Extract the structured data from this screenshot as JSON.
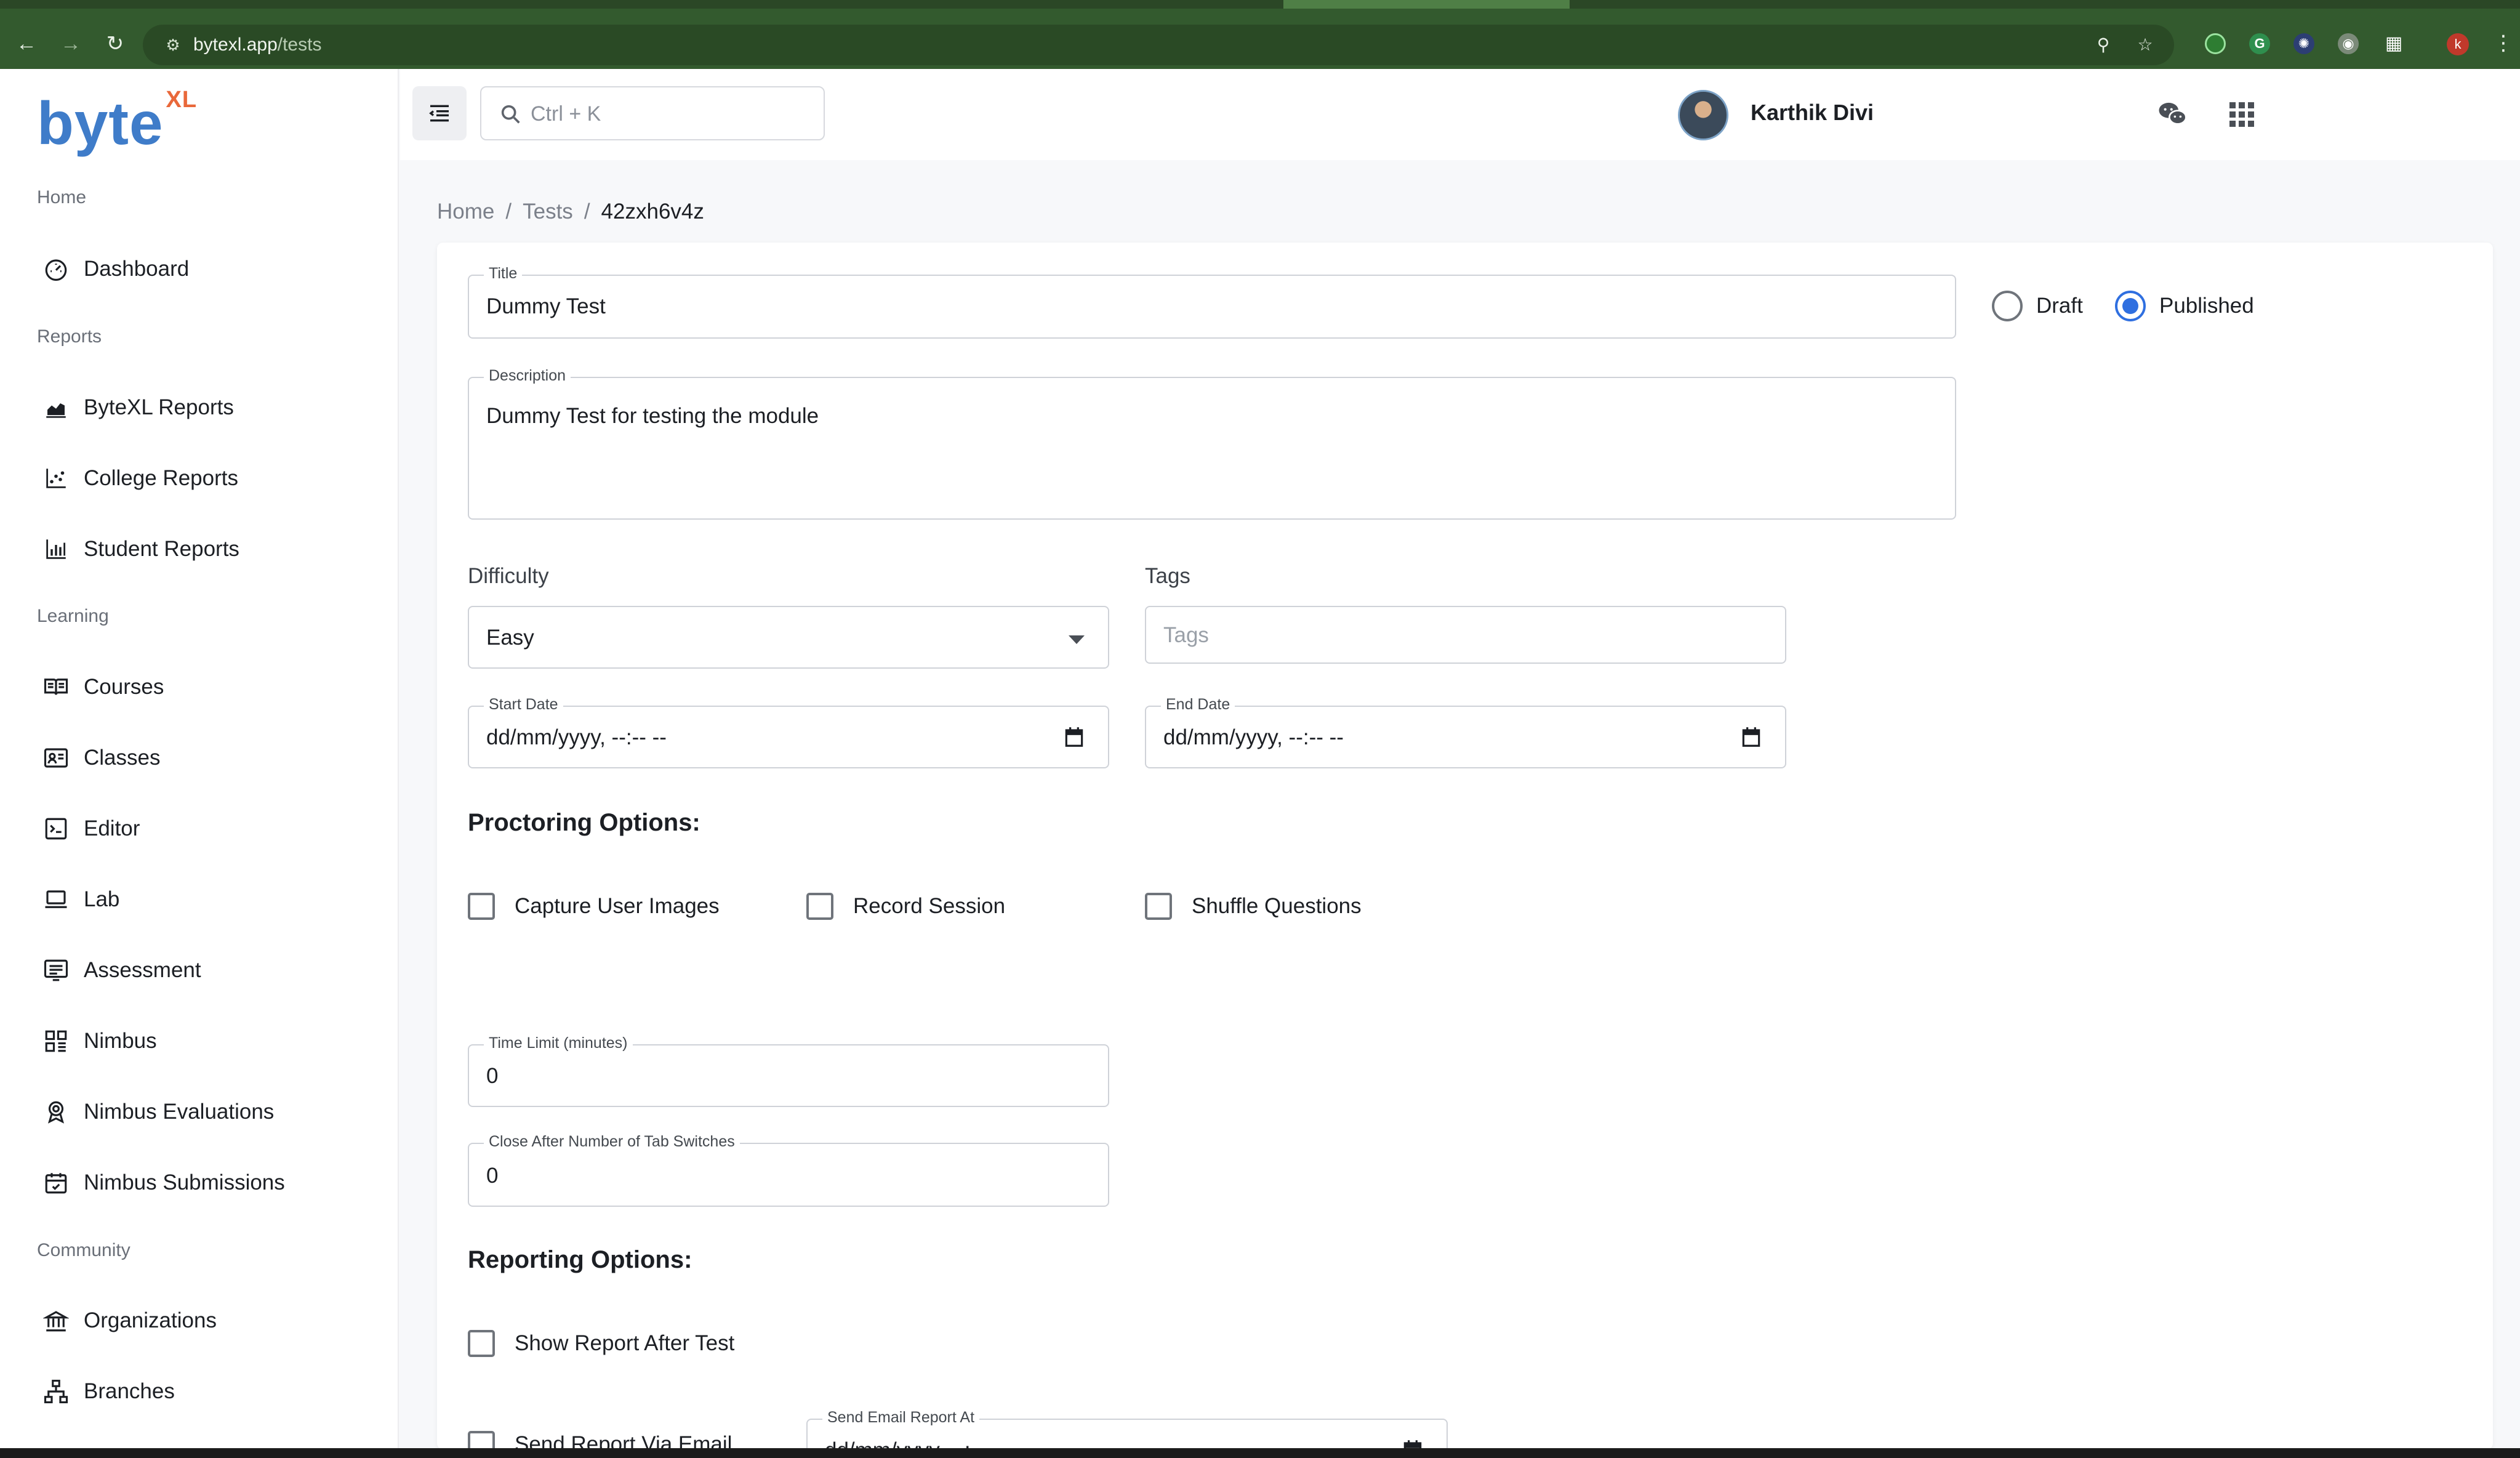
{
  "browser": {
    "url_host": "bytexl.app",
    "url_path": "/tests",
    "profile_initial": "k"
  },
  "sidebar": {
    "logo_text": "byte",
    "logo_super": "XL",
    "sections": {
      "home": "Home",
      "reports": "Reports",
      "learning": "Learning",
      "community": "Community"
    },
    "items": [
      {
        "label": "Dashboard",
        "icon": "dashboard-icon"
      },
      {
        "label": "ByteXL Reports",
        "icon": "area-chart-icon"
      },
      {
        "label": "College Reports",
        "icon": "scatter-chart-icon"
      },
      {
        "label": "Student Reports",
        "icon": "bar-chart-icon"
      },
      {
        "label": "Courses",
        "icon": "book-open-icon"
      },
      {
        "label": "Classes",
        "icon": "class-board-icon"
      },
      {
        "label": "Editor",
        "icon": "terminal-icon"
      },
      {
        "label": "Lab",
        "icon": "laptop-icon"
      },
      {
        "label": "Assessment",
        "icon": "assessment-list-icon"
      },
      {
        "label": "Nimbus",
        "icon": "grid-blocks-icon"
      },
      {
        "label": "Nimbus Evaluations",
        "icon": "award-badge-icon"
      },
      {
        "label": "Nimbus Submissions",
        "icon": "calendar-check-icon"
      },
      {
        "label": "Organizations",
        "icon": "institution-icon"
      },
      {
        "label": "Branches",
        "icon": "hierarchy-icon"
      }
    ]
  },
  "topbar": {
    "search_placeholder": "Ctrl + K",
    "user_name": "Karthik Divi"
  },
  "breadcrumb": {
    "home": "Home",
    "tests": "Tests",
    "current": "42zxh6v4z"
  },
  "form": {
    "title_label": "Title",
    "title_value": "Dummy Test",
    "status_draft": "Draft",
    "status_published": "Published",
    "status_selected": "Published",
    "description_label": "Description",
    "description_value": "Dummy Test for testing the module",
    "difficulty_label": "Difficulty",
    "difficulty_value": "Easy",
    "tags_label": "Tags",
    "tags_placeholder": "Tags",
    "start_date_label": "Start Date",
    "start_date_value": "dd/mm/yyyy, --:-- --",
    "end_date_label": "End Date",
    "end_date_value": "dd/mm/yyyy, --:-- --",
    "proctoring_heading": "Proctoring Options:",
    "capture_images": "Capture User Images",
    "record_session": "Record Session",
    "shuffle_questions": "Shuffle Questions",
    "time_limit_label": "Time Limit (minutes)",
    "time_limit_value": "0",
    "tab_switch_label": "Close After Number of Tab Switches",
    "tab_switch_value": "0",
    "reporting_heading": "Reporting Options:",
    "show_report": "Show Report After Test",
    "send_report_email": "Send Report Via Email",
    "send_email_at_label": "Send Email Report At",
    "send_email_at_value": "dd/mm/yyyy, --:-- --"
  }
}
